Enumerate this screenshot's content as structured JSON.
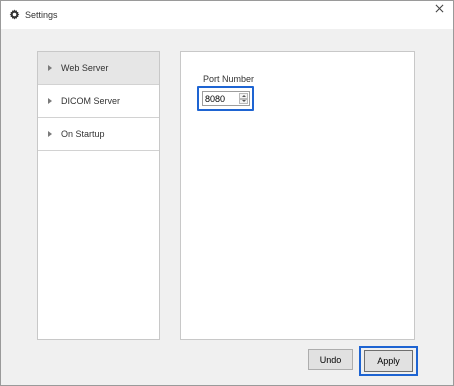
{
  "window": {
    "title": "Settings",
    "title_icon": "gear-icon",
    "close_icon": "close-icon"
  },
  "sidebar": {
    "items": [
      {
        "label": "Web Server",
        "selected": true
      },
      {
        "label": "DICOM Server",
        "selected": false
      },
      {
        "label": "On Startup",
        "selected": false
      }
    ]
  },
  "web_server": {
    "port_label": "Port Number",
    "port_value": "8080"
  },
  "buttons": {
    "undo": "Undo",
    "apply": "Apply"
  },
  "colors": {
    "focus": "#1e64d2",
    "selected_item": "#e6e6e6"
  }
}
